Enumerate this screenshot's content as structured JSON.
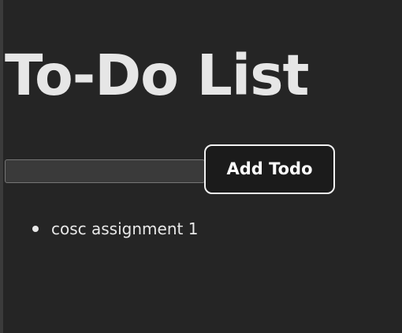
{
  "header": {
    "title": "To-Do List"
  },
  "form": {
    "input_value": "",
    "add_button_label": "Add Todo"
  },
  "todos": [
    {
      "text": "cosc assignment 1"
    }
  ],
  "colors": {
    "background": "#252525",
    "text": "#e8e8e8",
    "button_background": "#1b1b1b",
    "button_border": "#f2f2f2",
    "input_background": "#3a3a3a"
  }
}
